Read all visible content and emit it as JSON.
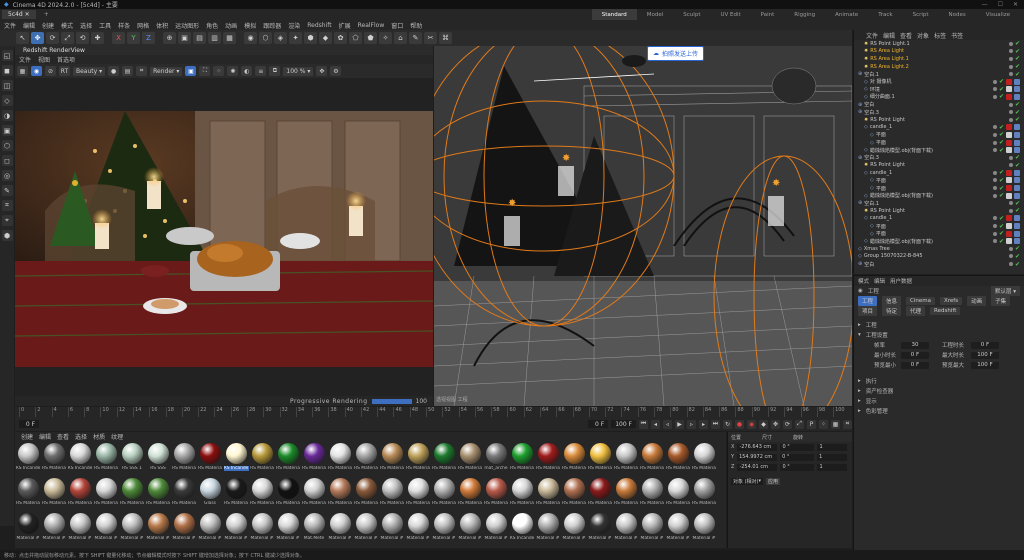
{
  "app": {
    "window_title": "Cinema 4D 2024.2.0 - [5c4d] - 主要",
    "doc_tab": "5c4d",
    "menus": [
      "文件",
      "编辑",
      "创建",
      "模式",
      "选择",
      "工具",
      "样条",
      "网格",
      "体积",
      "运动图形",
      "角色",
      "动画",
      "模拟",
      "跟踪器",
      "渲染",
      "Redshift",
      "扩展",
      "RealFlow",
      "窗口",
      "帮助"
    ],
    "layouts": [
      "Standard",
      "Model",
      "Sculpt",
      "UV Edit",
      "Paint",
      "Rigging",
      "Animate",
      "Track",
      "Script",
      "Nodes",
      "Visualize"
    ],
    "active_layout_index": 0
  },
  "toolbar": {
    "axis": [
      "X",
      "Y",
      "Z"
    ],
    "glyphs": [
      "↖",
      "✥",
      "⟳",
      "⤢",
      "⟲",
      "✚",
      "X",
      "Y",
      "Z",
      "⊕",
      "▣",
      "▤",
      "▥",
      "▦",
      "◉",
      "⬡",
      "◈",
      "✦",
      "⬢",
      "◆",
      "✿",
      "⬠",
      "⬟",
      "✧",
      "⌂",
      "✎",
      "✂",
      "⌘"
    ]
  },
  "left_tools": [
    "◱",
    "◼",
    "◫",
    "◇",
    "◑",
    "▣",
    "⬡",
    "◻",
    "◎",
    "✎",
    "⌗",
    "⌖",
    "⬢"
  ],
  "render_view": {
    "title": "Redshift RenderView",
    "menu": [
      "文件",
      "视图",
      "首选项"
    ],
    "toolbar_select_1": "Beauty",
    "toolbar_select_2": "Render",
    "zoom": "100 %",
    "progress_label": "Progressive Rendering",
    "status_value": "100"
  },
  "viewport": {
    "upload_label": "拍照发送上传",
    "info": "透视视图 工程"
  },
  "object_manager": {
    "tabs": [
      "文件",
      "编辑",
      "查看",
      "对象",
      "标签",
      "书签"
    ],
    "rows": [
      {
        "name": "RS Point Light.1",
        "indent": 1,
        "hl": false,
        "sel": false
      },
      {
        "name": "RS Area Light",
        "indent": 1,
        "hl": true,
        "sel": false
      },
      {
        "name": "RS Area Light.1",
        "indent": 1,
        "hl": true,
        "sel": false
      },
      {
        "name": "RS Area Light.2",
        "indent": 1,
        "hl": true,
        "sel": false
      },
      {
        "name": "空白.1",
        "indent": 0,
        "hl": false,
        "sel": false
      },
      {
        "name": "对 摄像机",
        "indent": 1,
        "hl": false,
        "sel": false
      },
      {
        "name": "环境",
        "indent": 1,
        "hl": false,
        "sel": false
      },
      {
        "name": "细分曲面.1",
        "indent": 1,
        "hl": false,
        "sel": false
      },
      {
        "name": "空白",
        "indent": 0,
        "hl": false,
        "sel": false
      },
      {
        "name": "空白.3",
        "indent": 0,
        "hl": false,
        "sel": false
      },
      {
        "name": "RS Point Light",
        "indent": 1,
        "hl": false,
        "sel": false
      },
      {
        "name": "candle_1",
        "indent": 1,
        "hl": false,
        "sel": false
      },
      {
        "name": "平面",
        "indent": 2,
        "hl": false,
        "sel": false
      },
      {
        "name": "平面",
        "indent": 2,
        "hl": false,
        "sel": false
      },
      {
        "name": "蜡烛烛焰模型.obj(背面下载)",
        "indent": 1,
        "hl": false,
        "sel": false
      },
      {
        "name": "空白.3",
        "indent": 0,
        "hl": false,
        "sel": false
      },
      {
        "name": "RS Point Light",
        "indent": 1,
        "hl": false,
        "sel": false
      },
      {
        "name": "candle_1",
        "indent": 1,
        "hl": false,
        "sel": false
      },
      {
        "name": "平面",
        "indent": 2,
        "hl": false,
        "sel": false
      },
      {
        "name": "平面",
        "indent": 2,
        "hl": false,
        "sel": false
      },
      {
        "name": "蜡烛烛焰模型.obj(背面下载)",
        "indent": 1,
        "hl": false,
        "sel": false
      },
      {
        "name": "空白.1",
        "indent": 0,
        "hl": false,
        "sel": false
      },
      {
        "name": "RS Point Light",
        "indent": 1,
        "hl": false,
        "sel": false
      },
      {
        "name": "candle_1",
        "indent": 1,
        "hl": false,
        "sel": false
      },
      {
        "name": "平面",
        "indent": 2,
        "hl": false,
        "sel": false
      },
      {
        "name": "平面",
        "indent": 2,
        "hl": false,
        "sel": false
      },
      {
        "name": "蜡烛烛焰模型.obj(背面下载)",
        "indent": 1,
        "hl": false,
        "sel": false
      },
      {
        "name": "Xmas Tree",
        "indent": 0,
        "hl": false,
        "sel": false
      },
      {
        "name": "Group 15070322-B-845",
        "indent": 0,
        "hl": false,
        "sel": false
      },
      {
        "name": "空白",
        "indent": 0,
        "hl": false,
        "sel": false
      }
    ]
  },
  "attribute_manager": {
    "tabs": [
      "模式",
      "编辑",
      "用户数据"
    ],
    "section": "工程",
    "sub_tabs": [
      "工程",
      "信息",
      "Cinema",
      "Xrefs",
      "动画",
      "子集"
    ],
    "sub_tabs2": [
      "项目",
      "待定",
      "代理",
      "Redshift"
    ],
    "groups": [
      "工程",
      "工程设置"
    ],
    "fields": [
      {
        "label": "帧率",
        "value": "30",
        "label2": "工程时长",
        "value2": "0 F"
      },
      {
        "label": "最小时长",
        "value": "0 F",
        "label2": "最大时长",
        "value2": "100 F"
      },
      {
        "label": "预览最小",
        "value": "0 F",
        "label2": "预览最大",
        "value2": "100 F"
      }
    ],
    "collapsed": [
      "执行",
      "资产检查器",
      "显示",
      "色彩管理"
    ],
    "layer_select": "默认层"
  },
  "timeline": {
    "ticks": [
      "0",
      "2",
      "4",
      "6",
      "8",
      "10",
      "12",
      "14",
      "16",
      "18",
      "20",
      "22",
      "24",
      "26",
      "28",
      "30",
      "32",
      "34",
      "36",
      "38",
      "40",
      "42",
      "44",
      "46",
      "48",
      "50",
      "52",
      "54",
      "56",
      "58",
      "60",
      "62",
      "64",
      "66",
      "68",
      "70",
      "72",
      "74",
      "76",
      "78",
      "80",
      "82",
      "84",
      "86",
      "88",
      "90",
      "92",
      "94",
      "96",
      "98",
      "100"
    ],
    "current": "0 F",
    "start": "0 F",
    "end": "100 F",
    "end2": "100 F",
    "fps_field": "0 F"
  },
  "materials": {
    "menu": [
      "创建",
      "编辑",
      "查看",
      "选择",
      "材质",
      "纹理"
    ],
    "items": [
      {
        "label": "RS Incande",
        "color": "#c8c8c8",
        "sel": false
      },
      {
        "label": "RS Materia",
        "color": "#6e6e6e",
        "sel": false
      },
      {
        "label": "RS Incande",
        "color": "#d9d9d9",
        "sel": false
      },
      {
        "label": "RS Materia",
        "color": "#9ab7a8",
        "sel": false
      },
      {
        "label": "RS SSS 1",
        "color": "#b8d0c0",
        "sel": false
      },
      {
        "label": "RS SSS",
        "color": "#d0e2d6",
        "sel": false
      },
      {
        "label": "RS Materia",
        "color": "#a8a8a8",
        "sel": false
      },
      {
        "label": "RS Materia",
        "color": "#8b0e0e",
        "sel": false
      },
      {
        "label": "RS Incande",
        "color": "#fff6d0",
        "sel": true
      },
      {
        "label": "RS Materia",
        "color": "#b89a3a",
        "sel": false
      },
      {
        "label": "RS Materia",
        "color": "#1c8b2a",
        "sel": false
      },
      {
        "label": "RS Materia",
        "color": "#6a2a9a",
        "sel": false
      },
      {
        "label": "RS Materia",
        "color": "#e4e4e4",
        "sel": false
      },
      {
        "label": "RS Materia",
        "color": "#a6a6a6",
        "sel": false
      },
      {
        "label": "RS Materia",
        "color": "#b88b57",
        "sel": false
      },
      {
        "label": "RS Materia",
        "color": "#bfa25a",
        "sel": false
      },
      {
        "label": "RS Materia",
        "color": "#1d7a2e",
        "sel": false
      },
      {
        "label": "RS Materia",
        "color": "#a89070",
        "sel": false
      },
      {
        "label": "mat_arche",
        "color": "#7a7a7a",
        "sel": false
      },
      {
        "label": "RS Materia",
        "color": "#1e9e2e",
        "sel": false
      },
      {
        "label": "RS Materia",
        "color": "#a01c1c",
        "sel": false
      },
      {
        "label": "RS Materia",
        "color": "#d98a3a",
        "sel": false
      },
      {
        "label": "RS Materia",
        "color": "#f0c040",
        "sel": false
      },
      {
        "label": "RS Materia",
        "color": "#c8c8c8",
        "sel": false
      },
      {
        "label": "RS Materia",
        "color": "#c87a3a",
        "sel": false
      },
      {
        "label": "RS Materia",
        "color": "#a85a2a",
        "sel": false
      },
      {
        "label": "RS Materia",
        "color": "#d6d6d6",
        "sel": false
      },
      {
        "label": "RS Materia",
        "color": "#5a5a5a",
        "sel": false
      },
      {
        "label": "RS Materia",
        "color": "#c9ba98",
        "sel": false
      },
      {
        "label": "RS Materia",
        "color": "#b3453a",
        "sel": false
      },
      {
        "label": "RS Materia",
        "color": "#d6d6d6",
        "sel": false
      },
      {
        "label": "RS Materia",
        "color": "#4e8a3a",
        "sel": false
      },
      {
        "label": "RS Materia",
        "color": "#4e8a3a",
        "sel": false
      },
      {
        "label": "RS Materia",
        "color": "#3a3a3a",
        "sel": false
      },
      {
        "label": "Glass",
        "color": "#c8d6e0",
        "sel": false
      },
      {
        "label": "RS Materia",
        "color": "#1a1a1a",
        "sel": false
      },
      {
        "label": "RS Materia",
        "color": "#d8d8d8",
        "sel": false
      },
      {
        "label": "RS Materia",
        "color": "#111111",
        "sel": false
      },
      {
        "label": "RS Materia",
        "color": "#d0d0d0",
        "sel": false
      },
      {
        "label": "RS Materia",
        "color": "#b47a5a",
        "sel": false
      },
      {
        "label": "RS Materia",
        "color": "#8a5a3a",
        "sel": false
      },
      {
        "label": "RS Materia",
        "color": "#c0c0c0",
        "sel": false
      },
      {
        "label": "RS Materia",
        "color": "#e0e0e0",
        "sel": false
      },
      {
        "label": "RS Materia",
        "color": "#b0b0b0",
        "sel": false
      },
      {
        "label": "RS Materia",
        "color": "#d07a3a",
        "sel": false
      },
      {
        "label": "RS Materia",
        "color": "#b85a4a",
        "sel": false
      },
      {
        "label": "RS Materia",
        "color": "#d6d6d6",
        "sel": false
      },
      {
        "label": "RS Materia",
        "color": "#c8b898",
        "sel": false
      },
      {
        "label": "RS Materia",
        "color": "#b07050",
        "sel": false
      },
      {
        "label": "RS Materia",
        "color": "#8a1a1a",
        "sel": false
      },
      {
        "label": "RS Materia",
        "color": "#c87a3a",
        "sel": false
      },
      {
        "label": "RS Materia",
        "color": "#b0b0b0",
        "sel": false
      },
      {
        "label": "RS Materia",
        "color": "#d8d8d8",
        "sel": false
      },
      {
        "label": "RS Materia",
        "color": "#a0a0a0",
        "sel": false
      },
      {
        "label": "Material #",
        "color": "#222222",
        "sel": false
      },
      {
        "label": "Material #",
        "color": "#b0b0b0",
        "sel": false
      },
      {
        "label": "Material #",
        "color": "#c8c8c8",
        "sel": false
      },
      {
        "label": "Material #",
        "color": "#d0d0d0",
        "sel": false
      },
      {
        "label": "Material #",
        "color": "#c0c0c0",
        "sel": false
      },
      {
        "label": "Material #",
        "color": "#b87a4a",
        "sel": false
      },
      {
        "label": "Material #",
        "color": "#b07048",
        "sel": false
      },
      {
        "label": "Material #",
        "color": "#c0c0c0",
        "sel": false
      },
      {
        "label": "Material #",
        "color": "#d0d0d0",
        "sel": false
      },
      {
        "label": "Material #",
        "color": "#c8c8c8",
        "sel": false
      },
      {
        "label": "Material #",
        "color": "#d8d8d8",
        "sel": false
      },
      {
        "label": "Mat.Mete",
        "color": "#b8b8b8",
        "sel": false
      },
      {
        "label": "Material #",
        "color": "#d0d0d0",
        "sel": false
      },
      {
        "label": "Material #",
        "color": "#c8c8c8",
        "sel": false
      },
      {
        "label": "Material #",
        "color": "#b0b0b0",
        "sel": false
      },
      {
        "label": "Material #",
        "color": "#d8d8d8",
        "sel": false
      },
      {
        "label": "Material #",
        "color": "#c0c0c0",
        "sel": false
      },
      {
        "label": "Material #",
        "color": "#b8b8b8",
        "sel": false
      },
      {
        "label": "Material #",
        "color": "#d0d0d0",
        "sel": false
      },
      {
        "label": "RS Incande",
        "color": "#ffffff",
        "sel": false
      },
      {
        "label": "Material #",
        "color": "#b0b0b0",
        "sel": false
      },
      {
        "label": "Material #",
        "color": "#d0d0d0",
        "sel": false
      },
      {
        "label": "Material #",
        "color": "#333333",
        "sel": false
      },
      {
        "label": "Material #",
        "color": "#c8c8c8",
        "sel": false
      },
      {
        "label": "Material #",
        "color": "#b8b8b8",
        "sel": false
      },
      {
        "label": "Material #",
        "color": "#d0d0d0",
        "sel": false
      },
      {
        "label": "Material #",
        "color": "#c0c0c0",
        "sel": false
      }
    ]
  },
  "coordinates": {
    "tabs": [
      "位置",
      "尺寸",
      "旋转"
    ],
    "rows": [
      {
        "axis": "X",
        "pos": "-276.643 cm",
        "rot": "0 °",
        "size": "1"
      },
      {
        "axis": "Y",
        "pos": "154.9972 cm",
        "rot": "0 °",
        "size": "1"
      },
      {
        "axis": "Z",
        "pos": "-254.01 cm",
        "rot": "0 °",
        "size": "1"
      }
    ],
    "mode1": "对象 (相对)",
    "mode2": "应用"
  },
  "status_bar": {
    "text": "移动：点击并拖动鼠标移动元素。按下 SHIFT 键量化移动；节点编辑模式时按下 SHIFT 键增加选择对象；按下 CTRL 键减少选择对象。"
  },
  "colors": {
    "accent": "#3d6ec0",
    "highlight_name": "#f0b429",
    "check_green": "#51c251"
  }
}
